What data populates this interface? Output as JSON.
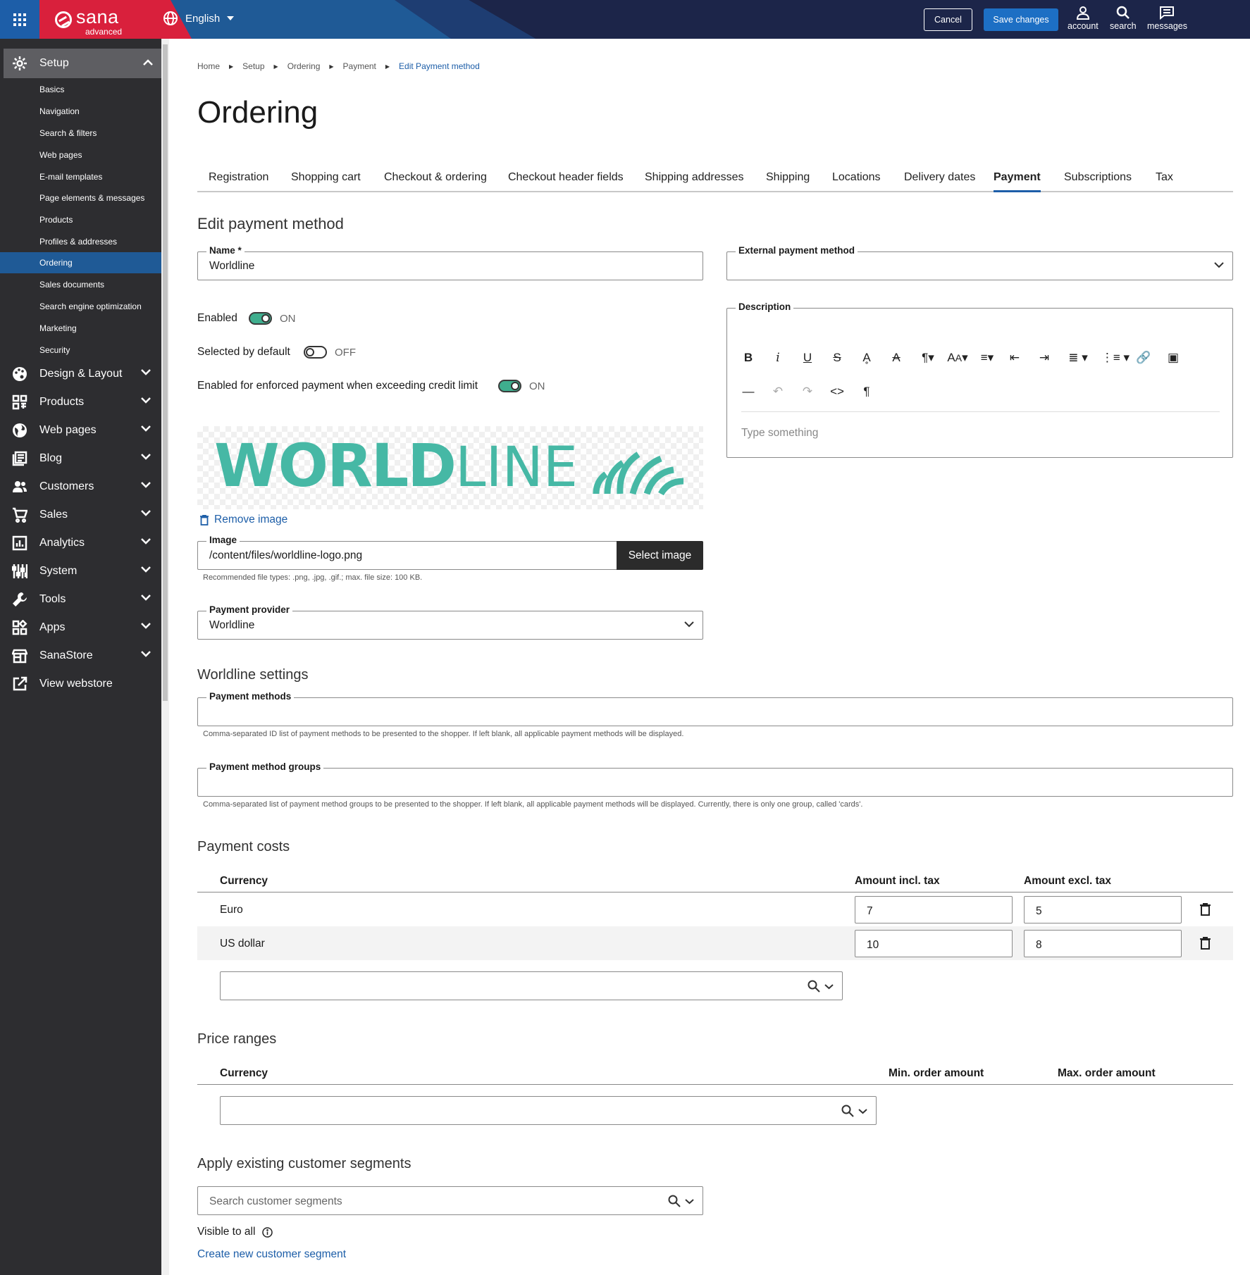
{
  "topbar": {
    "brand_name": "sana",
    "brand_sub": "advanced",
    "language": "English",
    "cancel_label": "Cancel",
    "save_label": "Save changes",
    "tools": [
      {
        "label": "account",
        "icon": "account-icon"
      },
      {
        "label": "search",
        "icon": "search-icon"
      },
      {
        "label": "messages",
        "icon": "messages-icon"
      }
    ],
    "colors": {
      "navy": "#1c2549",
      "blue": "#1d5ea8",
      "brand_red": "#d9203c"
    }
  },
  "sidebar": {
    "section": "Setup",
    "sub_items": [
      "Basics",
      "Navigation",
      "Search & filters",
      "Web pages",
      "E-mail templates",
      "Page elements & messages",
      "Products",
      "Profiles & addresses",
      "Ordering",
      "Sales documents",
      "Search engine optimization",
      "Marketing",
      "Security"
    ],
    "active_sub_item": "Ordering",
    "items": [
      {
        "label": "Design & Layout",
        "icon": "palette-icon"
      },
      {
        "label": "Products",
        "icon": "products-grid-icon"
      },
      {
        "label": "Web pages",
        "icon": "globe-icon"
      },
      {
        "label": "Blog",
        "icon": "blog-icon"
      },
      {
        "label": "Customers",
        "icon": "customers-icon"
      },
      {
        "label": "Sales",
        "icon": "cart-icon"
      },
      {
        "label": "Analytics",
        "icon": "analytics-icon"
      },
      {
        "label": "System",
        "icon": "system-icon"
      },
      {
        "label": "Tools",
        "icon": "wrench-icon"
      },
      {
        "label": "Apps",
        "icon": "apps-icon"
      },
      {
        "label": "SanaStore",
        "icon": "store-icon"
      },
      {
        "label": "View webstore",
        "icon": "external-link-icon"
      }
    ]
  },
  "breadcrumb": [
    "Home",
    "Setup",
    "Ordering",
    "Payment",
    "Edit Payment method"
  ],
  "page_title": "Ordering",
  "tabs": [
    "Registration",
    "Shopping cart",
    "Checkout & ordering",
    "Checkout header fields",
    "Shipping addresses",
    "Shipping",
    "Locations",
    "Delivery dates",
    "Payment",
    "Subscriptions",
    "Tax"
  ],
  "active_tab": "Payment",
  "form": {
    "heading": "Edit payment method",
    "name_label": "Name *",
    "name_value": "Worldline",
    "external_label": "External payment method",
    "external_value": "",
    "enabled_label": "Enabled",
    "enabled_state": "ON",
    "selected_default_label": "Selected by default",
    "selected_default_state": "OFF",
    "enforced_label": "Enabled for enforced payment when exceeding credit limit",
    "enforced_state": "ON",
    "logo_text_bold": "WORLD",
    "logo_text_light": "LINE",
    "remove_image": "Remove image",
    "image_label": "Image",
    "image_value": "/content/files/worldline-logo.png",
    "select_image": "Select image",
    "image_hint": "Recommended file types: .png, .jpg, .gif.; max. file size: 100 KB.",
    "provider_label": "Payment provider",
    "provider_value": "Worldline",
    "description_label": "Description",
    "description_placeholder": "Type something",
    "accent_color": "#3fae8e"
  },
  "worldline": {
    "heading": "Worldline settings",
    "methods_label": "Payment methods",
    "methods_hint": "Comma-separated ID list of payment methods to be presented to the shopper. If left blank, all applicable payment methods will be displayed.",
    "groups_label": "Payment method groups",
    "groups_hint": "Comma-separated list of payment method groups to be presented to the shopper. If left blank, all applicable payment methods will be displayed. Currently, there is only one group, called 'cards'."
  },
  "payment_costs": {
    "heading": "Payment costs",
    "columns": [
      "Currency",
      "Amount incl. tax",
      "Amount excl. tax"
    ],
    "rows": [
      {
        "currency": "Euro",
        "incl": "7",
        "excl": "5"
      },
      {
        "currency": "US dollar",
        "incl": "10",
        "excl": "8"
      }
    ]
  },
  "price_ranges": {
    "heading": "Price ranges",
    "columns": [
      "Currency",
      "Min. order amount",
      "Max. order amount"
    ]
  },
  "segments": {
    "heading": "Apply existing customer segments",
    "search_placeholder": "Search customer segments",
    "visible_label": "Visible to all",
    "create_link": "Create new customer segment"
  }
}
